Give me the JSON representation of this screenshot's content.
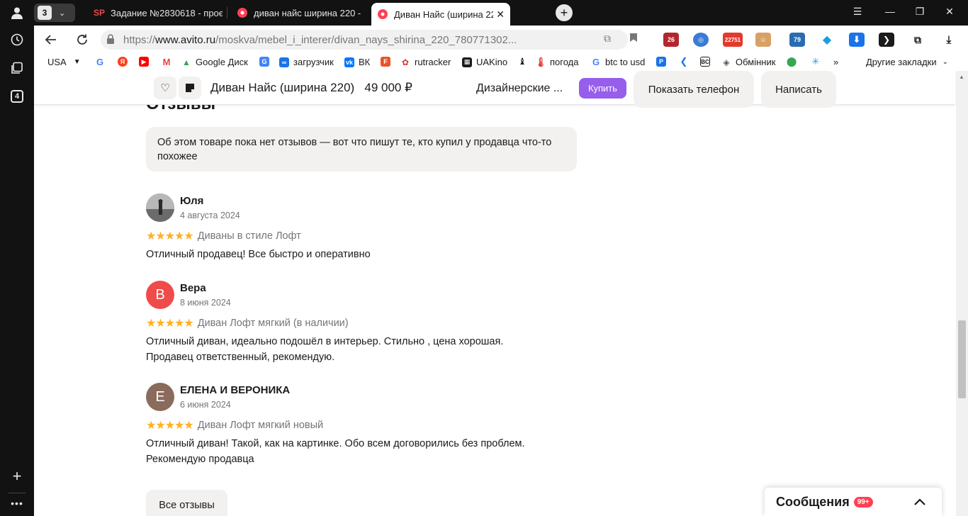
{
  "sidebar": {
    "counter": "4"
  },
  "tabs": {
    "group_count": "3",
    "items": [
      {
        "icon_text": "SP",
        "title": "Задание №2830618 - проє"
      },
      {
        "icon_text": "",
        "title": "диван найс ширина 220 -"
      },
      {
        "icon_text": "",
        "title": "Диван Найс (ширина 220)"
      }
    ]
  },
  "address": {
    "url_prefix": "https://",
    "url_host": "www.avito.ru",
    "url_path": "/moskva/mebel_i_interer/divan_nays_shirina_220_780771302..."
  },
  "extensions": {
    "badge_26": "26",
    "badge_count": "22751",
    "badge_79": "79"
  },
  "bookmarks": {
    "region": "USA",
    "items": [
      {
        "label": "Google Диск"
      },
      {
        "label": "загрузчик"
      },
      {
        "label": "ВК"
      },
      {
        "label": "rutracker"
      },
      {
        "label": "UAKino"
      },
      {
        "label": "погода"
      },
      {
        "label": "btc to usd"
      },
      {
        "label": "Обмінник"
      }
    ],
    "more": "»",
    "other": "Другие закладки"
  },
  "sticky": {
    "title": "Диван Найс (ширина 220)",
    "price": "49 000 ₽",
    "seller": "Дизайнерские ...",
    "buy": "Купить",
    "phone": "Показать телефон",
    "write": "Написать"
  },
  "reviews": {
    "heading": "Отзывы",
    "notice": "Об этом товаре пока нет отзывов — вот что пишут те, кто купил у продавца что-то похожее",
    "items": [
      {
        "initial": "",
        "name": "Юля",
        "date": "4 августа 2024",
        "stars": "★★★★★",
        "product": "Диваны в стиле Лофт",
        "text1": "Отличный продавец! Все быстро и оперативно",
        "text2": ""
      },
      {
        "initial": "В",
        "name": "Вера",
        "date": "8 июня 2024",
        "stars": "★★★★★",
        "product": "Диван Лофт мягкий (в наличии)",
        "text1": "Отличный диван, идеально подошёл в интерьер. Стильно , цена хорошая.",
        "text2": "Продавец ответственный, рекомендую."
      },
      {
        "initial": "Е",
        "name": "ЕЛЕНА И ВЕРОНИКА",
        "date": "6 июня 2024",
        "stars": "★★★★★",
        "product": "Диван Лофт мягкий новый",
        "text1": "Отличный диван! Такой, как на картинке. Обо всем договорились без проблем.",
        "text2": "Рекомендую продавца"
      }
    ],
    "all_button": "Все отзывы"
  },
  "messages": {
    "title": "Сообщения",
    "badge": "99+"
  },
  "colors": {
    "accent_purple": "#965eeb",
    "star_yellow": "#ffb021",
    "badge_red": "#ff4053",
    "avatar_red": "#ef4b4b",
    "avatar_brown": "#8a6b5c"
  }
}
